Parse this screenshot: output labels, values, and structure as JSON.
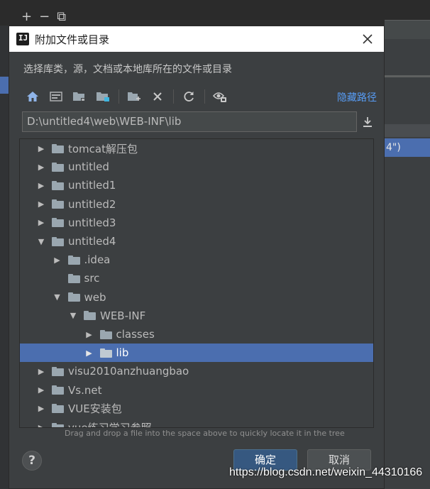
{
  "background": {
    "toolbar_icons": [
      "+",
      "−",
      "⧉"
    ],
    "right_selected_text": "4\")"
  },
  "dialog": {
    "title": "附加文件或目录",
    "description": "选择库类，源，文档或本地库所在的文件或目录",
    "hide_path_label": "隐藏路径",
    "path_value": "D:\\untitled4\\web\\WEB-INF\\lib",
    "toolbar_icons": [
      "home-icon",
      "desktop-icon",
      "project-folder-icon",
      "module-folder-icon",
      "new-folder-icon",
      "delete-icon",
      "refresh-icon",
      "show-hidden-icon"
    ],
    "tree": [
      {
        "label": "tomcat解压包",
        "depth": 0,
        "expanded": false,
        "has_arrow": true
      },
      {
        "label": "untitled",
        "depth": 0,
        "expanded": false,
        "has_arrow": true
      },
      {
        "label": "untitled1",
        "depth": 0,
        "expanded": false,
        "has_arrow": true
      },
      {
        "label": "untitled2",
        "depth": 0,
        "expanded": false,
        "has_arrow": true
      },
      {
        "label": "untitled3",
        "depth": 0,
        "expanded": false,
        "has_arrow": true
      },
      {
        "label": "untitled4",
        "depth": 0,
        "expanded": true,
        "has_arrow": true
      },
      {
        "label": ".idea",
        "depth": 1,
        "expanded": false,
        "has_arrow": true
      },
      {
        "label": "src",
        "depth": 1,
        "expanded": false,
        "has_arrow": false
      },
      {
        "label": "web",
        "depth": 1,
        "expanded": true,
        "has_arrow": true
      },
      {
        "label": "WEB-INF",
        "depth": 2,
        "expanded": true,
        "has_arrow": true
      },
      {
        "label": "classes",
        "depth": 3,
        "expanded": false,
        "has_arrow": true
      },
      {
        "label": "lib",
        "depth": 3,
        "expanded": false,
        "has_arrow": true,
        "selected": true
      },
      {
        "label": "visu2010anzhuangbao",
        "depth": 0,
        "expanded": false,
        "has_arrow": true
      },
      {
        "label": "Vs.net",
        "depth": 0,
        "expanded": false,
        "has_arrow": true
      },
      {
        "label": "VUE安装包",
        "depth": 0,
        "expanded": false,
        "has_arrow": true
      },
      {
        "label": "vue练习学习参照",
        "depth": 0,
        "expanded": false,
        "has_arrow": true
      }
    ],
    "drag_hint": "Drag and drop a file into the space above to quickly locate it in the tree",
    "help_label": "?",
    "ok_label": "确定",
    "cancel_label": "取消"
  },
  "watermark": "https://blog.csdn.net/weixin_44310166",
  "colors": {
    "accent": "#4b6eaf",
    "link": "#589df6",
    "ok_button": "#365880"
  }
}
